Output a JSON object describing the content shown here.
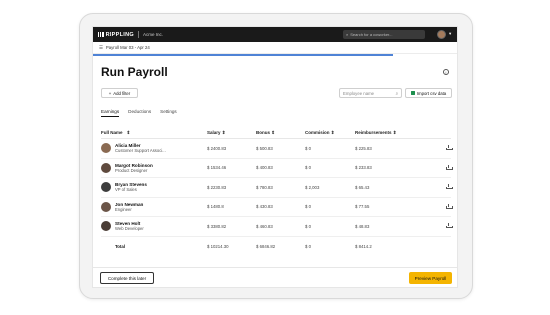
{
  "app": {
    "brand": "RIPPLING",
    "company": "Acme Inc.",
    "search_placeholder": "Search for a coworker...",
    "breadcrumb": "Payroll Mar 03 - Apr 24"
  },
  "page": {
    "title": "Run Payroll",
    "add_filter_label": "Add filter",
    "employee_search_placeholder": "Employee name",
    "import_label": "Import csv data",
    "tabs": [
      "Earnings",
      "Deductions",
      "Settings"
    ],
    "active_tab": "Earnings"
  },
  "table": {
    "headers": [
      "Full Name",
      "Salary",
      "Bonus",
      "Commision",
      "Reimbursements"
    ],
    "rows": [
      {
        "name": "Alicia Miller",
        "role": "Customer Support Associ...",
        "salary": "$ 2400.83",
        "bonus": "$ 500.83",
        "commission": "$ 0",
        "reimbursements": "$ 225.83",
        "avatar_color": "#8a6a52"
      },
      {
        "name": "Margot Robinson",
        "role": "Product Designer",
        "salary": "$ 1534.46",
        "bonus": "$ 400.83",
        "commission": "$ 0",
        "reimbursements": "$ 233.83",
        "avatar_color": "#5f4a3e"
      },
      {
        "name": "Bryan Stevens",
        "role": "VP of Sales",
        "salary": "$ 2230.83",
        "bonus": "$ 780.83",
        "commission": "$ 2,003",
        "reimbursements": "$ 65.43",
        "avatar_color": "#3d3d3d"
      },
      {
        "name": "Jon Newman",
        "role": "Engineer",
        "salary": "$ 1480.8",
        "bonus": "$ 430.83",
        "commission": "$ 0",
        "reimbursements": "$ 77.55",
        "avatar_color": "#6b5548"
      },
      {
        "name": "Steven Holt",
        "role": "Web Developer",
        "salary": "$ 3380.82",
        "bonus": "$ 460.83",
        "commission": "$ 0",
        "reimbursements": "$ 48.83",
        "avatar_color": "#4a3d36"
      }
    ],
    "total": {
      "label": "Total",
      "salary": "$ 10214.30",
      "bonus": "$ 6846.82",
      "commission": "$ 0",
      "reimbursements": "$ 8414.2"
    }
  },
  "footer": {
    "complete_later_label": "Complete this later",
    "preview_label": "Preview Payroll"
  },
  "colors": {
    "accent": "#f4b400",
    "topbar": "#1a1a1a",
    "progress": "#4f83d6"
  }
}
